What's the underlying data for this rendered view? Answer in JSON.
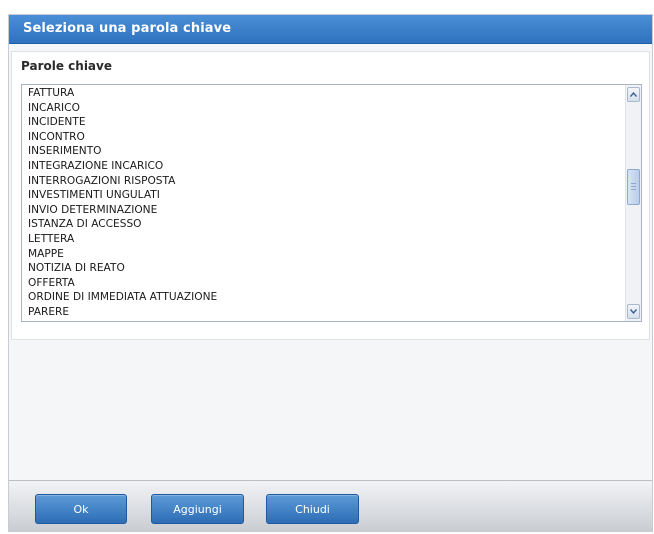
{
  "dialog": {
    "title": "Seleziona una parola chiave"
  },
  "panel": {
    "label": "Parole chiave",
    "items": [
      "FATTURA",
      "INCARICO",
      "INCIDENTE",
      "INCONTRO",
      "INSERIMENTO",
      "INTEGRAZIONE INCARICO",
      "INTERROGAZIONI RISPOSTA",
      "INVESTIMENTI UNGULATI",
      "INVIO DETERMINAZIONE",
      "ISTANZA DI ACCESSO",
      "LETTERA",
      "MAPPE",
      "NOTIZIA DI REATO",
      "OFFERTA",
      "ORDINE DI IMMEDIATA ATTUAZIONE",
      "PARERE"
    ],
    "scroll_position": 0.4
  },
  "footer": {
    "ok_label": "Ok",
    "add_label": "Aggiungi",
    "close_label": "Chiudi"
  },
  "colors": {
    "accent": "#2f73c0",
    "button": "#3f82c8"
  },
  "icons": {
    "scroll_up": "chevron-up-icon",
    "scroll_down": "chevron-down-icon"
  }
}
